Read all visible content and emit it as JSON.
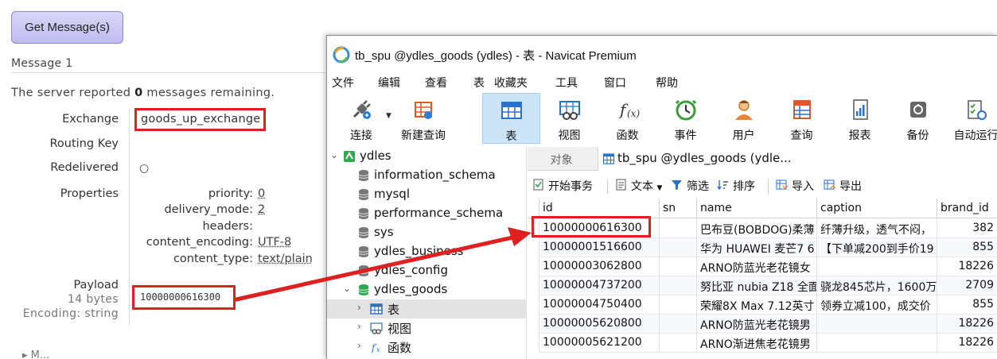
{
  "rabbitmq": {
    "get_button": "Get Message(s)",
    "message_heading": "Message 1",
    "server_report_prefix": "The server reported ",
    "server_report_count": "0",
    "server_report_suffix": " messages remaining.",
    "fields": {
      "exchange_label": "Exchange",
      "exchange_value": "goods_up_exchange",
      "routing_key_label": "Routing Key",
      "redelivered_label": "Redelivered",
      "redelivered_value": "○",
      "properties_label": "Properties",
      "payload_label": "Payload",
      "payload_size": "14 bytes",
      "payload_encoding": "Encoding: string",
      "payload_value": "10000000616300"
    },
    "properties": [
      {
        "key": "priority:",
        "value": "0"
      },
      {
        "key": "delivery_mode:",
        "value": "2"
      },
      {
        "key": "headers:",
        "value": ""
      },
      {
        "key": "content_encoding:",
        "value": "UTF-8"
      },
      {
        "key": "content_type:",
        "value": "text/plain"
      }
    ],
    "bottom_partial": "▸  M..."
  },
  "navicat": {
    "title": "tb_spu @ydles_goods (ydles) - 表 - Navicat Premium",
    "menu": [
      "文件",
      "编辑",
      "查看",
      "表",
      "收藏夹",
      "工具",
      "窗口",
      "帮助"
    ],
    "toolbar": [
      {
        "label": "连接",
        "icon": "plug-icon"
      },
      {
        "label": "新建查询",
        "icon": "new-query-icon"
      },
      {
        "label": "表",
        "icon": "table-icon"
      },
      {
        "label": "视图",
        "icon": "view-icon"
      },
      {
        "label": "函数",
        "icon": "function-icon"
      },
      {
        "label": "事件",
        "icon": "clock-icon"
      },
      {
        "label": "用户",
        "icon": "user-icon"
      },
      {
        "label": "查询",
        "icon": "query-icon"
      },
      {
        "label": "报表",
        "icon": "report-icon"
      },
      {
        "label": "备份",
        "icon": "backup-icon"
      },
      {
        "label": "自动运行",
        "icon": "schedule-icon"
      }
    ],
    "tree": {
      "connection": "ydles",
      "databases": [
        "information_schema",
        "mysql",
        "performance_schema",
        "sys",
        "ydles_business",
        "ydles_config",
        "ydles_goods"
      ],
      "children": [
        {
          "label": "表",
          "icon": "table-icon"
        },
        {
          "label": "视图",
          "icon": "view-icon"
        },
        {
          "label": "函数",
          "icon": "function-icon"
        }
      ]
    },
    "tabs": {
      "objects": "对象",
      "active": "tb_spu @ydles_goods (ydle..."
    },
    "subtoolbar": [
      "开始事务",
      "文本",
      "筛选",
      "排序",
      "导入",
      "导出"
    ],
    "grid": {
      "columns": [
        "id",
        "sn",
        "name",
        "caption",
        "brand_id"
      ],
      "rows": [
        [
          "10000000616300",
          "",
          "巴布豆(BOBDOG)柔薄",
          "纤薄升级，透气不闷，",
          "382"
        ],
        [
          "10000001516600",
          "",
          "华为 HUAWEI 麦芒7 6",
          "【下单减200到手价19",
          "855"
        ],
        [
          "10000003062800",
          "",
          "ARNO防蓝光老花镜女",
          "",
          "18226"
        ],
        [
          "10000004737200",
          "",
          "努比亚 nubia Z18 全面",
          "骁龙845芯片，1600万",
          "2709"
        ],
        [
          "10000004750400",
          "",
          "荣耀8X Max 7.12英寸",
          "领券立减100，成交价",
          "855"
        ],
        [
          "10000005620800",
          "",
          "ARNO防蓝光老花镜男",
          "",
          "18226"
        ],
        [
          "10000005621200",
          "",
          "ARNO渐进焦老花镜男",
          "",
          "18226"
        ]
      ]
    }
  },
  "colors": {
    "highlight_red": "#e02020",
    "active_tool": "#cce4f7",
    "button_purple": "#c9c6f3"
  }
}
